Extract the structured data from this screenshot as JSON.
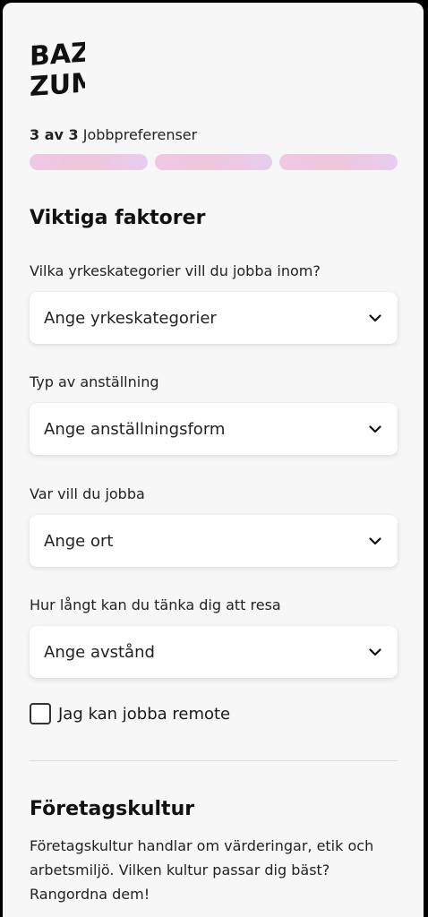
{
  "logo": {
    "alt": "BAZ ZUM",
    "line1": "BAZ",
    "line2": "ZUM"
  },
  "progress": {
    "step_current": "3 av 3",
    "step_label": "Jobbpreferenser",
    "segments": 3,
    "completed": 3
  },
  "section_important": {
    "title": "Viktiga faktorer",
    "fields": [
      {
        "label": "Vilka yrkeskategorier vill du jobba inom?",
        "placeholder": "Ange yrkeskategorier"
      },
      {
        "label": "Typ av anställning",
        "placeholder": "Ange anställningsform"
      },
      {
        "label": "Var vill du jobba",
        "placeholder": "Ange ort"
      },
      {
        "label": "Hur långt kan du tänka dig att resa",
        "placeholder": "Ange avstånd"
      }
    ],
    "remote_checkbox": {
      "label": "Jag kan jobba remote",
      "checked": false
    }
  },
  "section_culture": {
    "title": "Företagskultur",
    "description": "Företagskultur handlar om värderingar, etik och arbetsmiljö. Vilken kultur passar dig bäst? Rangordna dem!"
  },
  "colors": {
    "background": "#f7f7f7",
    "progress_gradient_start": "#f2c7e3",
    "progress_gradient_end": "#e7cdf0",
    "text": "#1a1a1a"
  },
  "icons": {
    "select_chevron": "chevron-down-icon"
  }
}
